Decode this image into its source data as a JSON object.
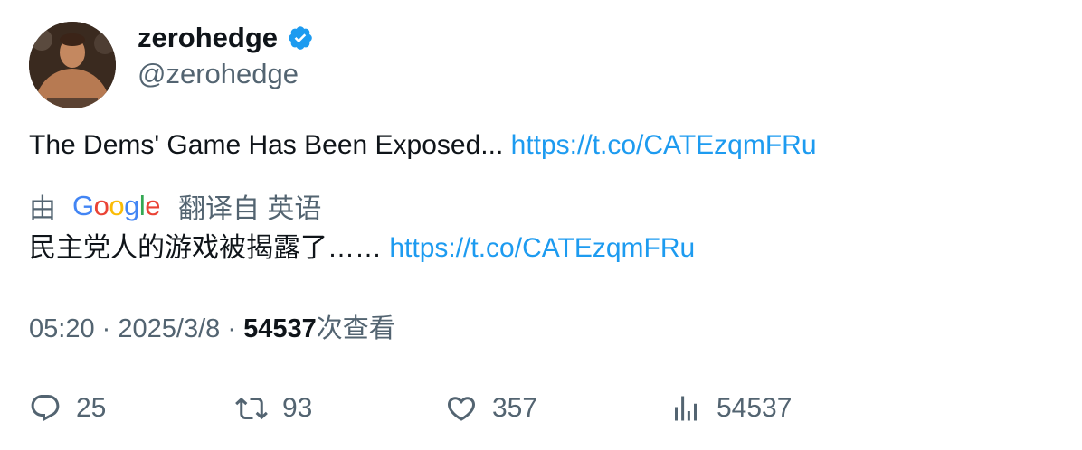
{
  "user": {
    "display_name": "zerohedge",
    "handle": "@zerohedge",
    "verified": true,
    "avatar_icon": "avatar"
  },
  "tweet": {
    "text": "The Dems' Game Has Been Exposed...",
    "link": "https://t.co/CATEzqmFRu"
  },
  "translation": {
    "by_label": "由",
    "provider": "Google",
    "translated_from": "翻译自 英语",
    "text": "民主党人的游戏被揭露了……",
    "link": "https://t.co/CATEzqmFRu"
  },
  "meta": {
    "time": "05:20",
    "separator": "·",
    "date": "2025/3/8",
    "views": "54537",
    "views_label": "次查看"
  },
  "actions": {
    "replies": "25",
    "retweets": "93",
    "likes": "357",
    "views": "54537"
  },
  "colors": {
    "accent": "#1d9bf0",
    "secondary_text": "#536471",
    "primary_text": "#0f1419"
  }
}
